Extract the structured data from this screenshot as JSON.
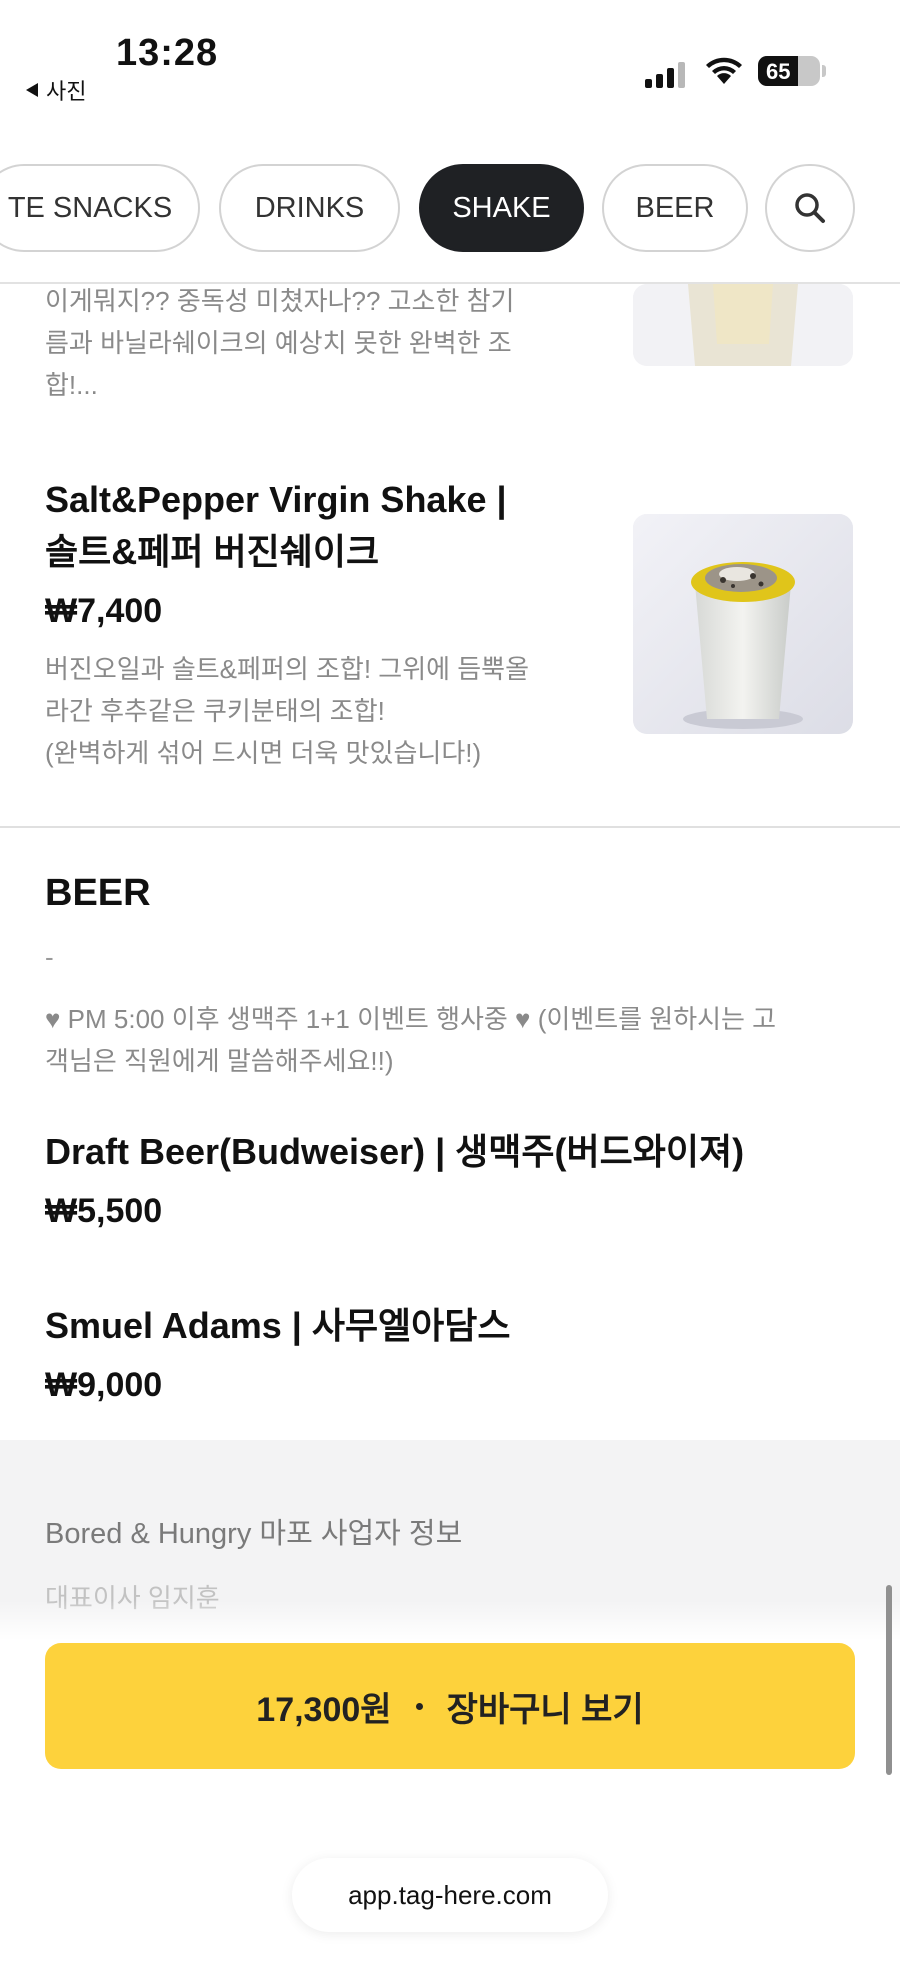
{
  "status_bar": {
    "time": "13:28",
    "back_label": "사진",
    "battery": "65",
    "battery_level": 0.65
  },
  "tabs": [
    {
      "label": "TE SNACKS",
      "active": false
    },
    {
      "label": "DRINKS",
      "active": false
    },
    {
      "label": "SHAKE",
      "active": true
    },
    {
      "label": "BEER",
      "active": false
    }
  ],
  "icons": {
    "search": "search-icon",
    "back": "back-arrow-icon",
    "signal": "cellular-signal-icon",
    "wifi": "wifi-icon",
    "battery": "battery-icon"
  },
  "menu": {
    "prev_item": {
      "desc_lines": [
        "이게뭐지?? 중독성 미쳤자나?? 고소한 참기",
        "름과 바닐라쉐이크의 예상치 못한 완벽한 조",
        "합!..."
      ]
    },
    "salt_pepper": {
      "name_lines": [
        "Salt&Pepper Virgin Shake |",
        "솔트&페퍼 버진쉐이크"
      ],
      "price": "₩7,400",
      "desc_lines": [
        "버진오일과 솔트&페퍼의 조합! 그위에 듬뿍올",
        "라간 후추같은 쿠키분태의 조합!",
        "(완벽하게 섞어 드시면 더욱 맛있습니다!)"
      ]
    },
    "beer_section": {
      "title": "BEER",
      "dash": "-",
      "notice_lines": [
        "♥ PM 5:00 이후 생맥주 1+1 이벤트 행사중 ♥ (이벤트를 원하시는 고",
        "객님은 직원에게 말씀해주세요!!)"
      ]
    },
    "draft_beer": {
      "name": "Draft Beer(Budweiser) | 생맥주(버드와이져)",
      "price": "₩5,500"
    },
    "samuel": {
      "name": "Smuel Adams | 사무엘아담스",
      "price": "₩9,000"
    }
  },
  "footer": {
    "info_title": "Bored & Hungry 마포 사업자 정보",
    "info_sub": "대표이사    임지훈"
  },
  "cart": {
    "amount": "17,300원",
    "label": "장바구니 보기"
  },
  "url": "app.tag-here.com",
  "colors": {
    "accent": "#fdd23c",
    "active_tab": "#1f2124"
  }
}
